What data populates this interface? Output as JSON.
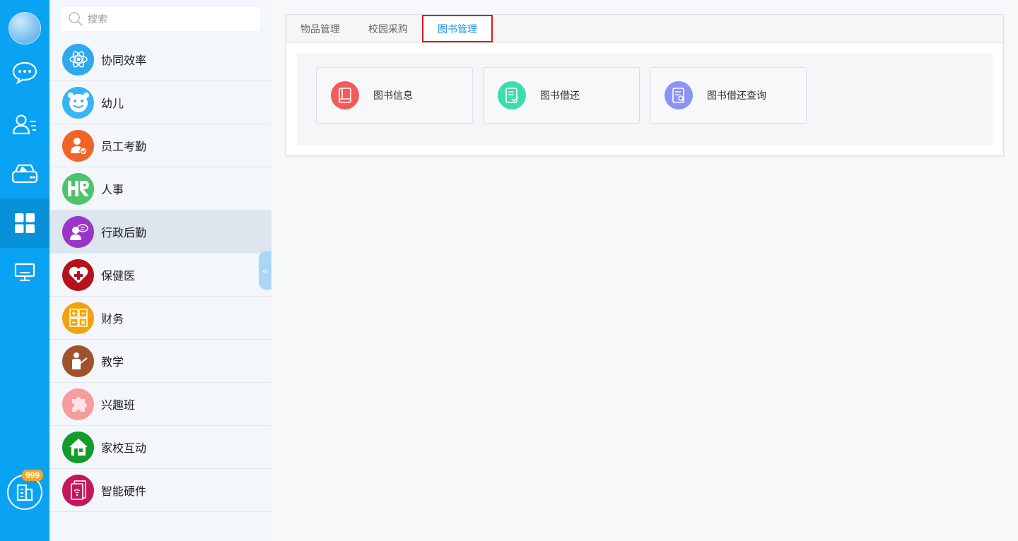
{
  "rail": {
    "items": [
      {
        "name": "chat-icon",
        "active": false
      },
      {
        "name": "contacts-icon",
        "active": false
      },
      {
        "name": "cloud-drive-icon",
        "active": false
      },
      {
        "name": "apps-grid-icon",
        "active": true
      },
      {
        "name": "monitor-icon",
        "active": false
      }
    ],
    "bottom_badge": "999",
    "accent": "#0aa2f2"
  },
  "search": {
    "placeholder": "搜索"
  },
  "modules": [
    {
      "label": "协同效率",
      "color": "#2fa9ee",
      "icon": "atom-icon"
    },
    {
      "label": "幼儿",
      "color": "#35b5f3",
      "icon": "smiley-icon"
    },
    {
      "label": "员工考勤",
      "color": "#f06428",
      "icon": "employee-check-icon"
    },
    {
      "label": "人事",
      "color": "#4fc36a",
      "icon": "hr-icon"
    },
    {
      "label": "行政后勤",
      "color": "#9b34c8",
      "icon": "admin-speaker-icon"
    },
    {
      "label": "保健医",
      "color": "#b5121b",
      "icon": "health-heart-icon"
    },
    {
      "label": "财务",
      "color": "#f4a20c",
      "icon": "calculator-icon"
    },
    {
      "label": "教学",
      "color": "#a0522d",
      "icon": "teacher-icon"
    },
    {
      "label": "兴趣班",
      "color": "#f59d9d",
      "icon": "puzzle-icon"
    },
    {
      "label": "家校互动",
      "color": "#139b2c",
      "icon": "home-icon"
    },
    {
      "label": "智能硬件",
      "color": "#c2185b",
      "icon": "smart-device-icon"
    }
  ],
  "active_module": "行政后勤",
  "tabs": [
    {
      "label": "物品管理",
      "active": false
    },
    {
      "label": "校园采购",
      "active": false
    },
    {
      "label": "图书管理",
      "active": true
    }
  ],
  "cards": [
    {
      "label": "图书信息",
      "color": "#f25b5b",
      "icon": "book-icon"
    },
    {
      "label": "图书借还",
      "color": "#3ddbb0",
      "icon": "book-return-icon"
    },
    {
      "label": "图书借还查询",
      "color": "#8c93f5",
      "icon": "book-search-icon"
    }
  ]
}
